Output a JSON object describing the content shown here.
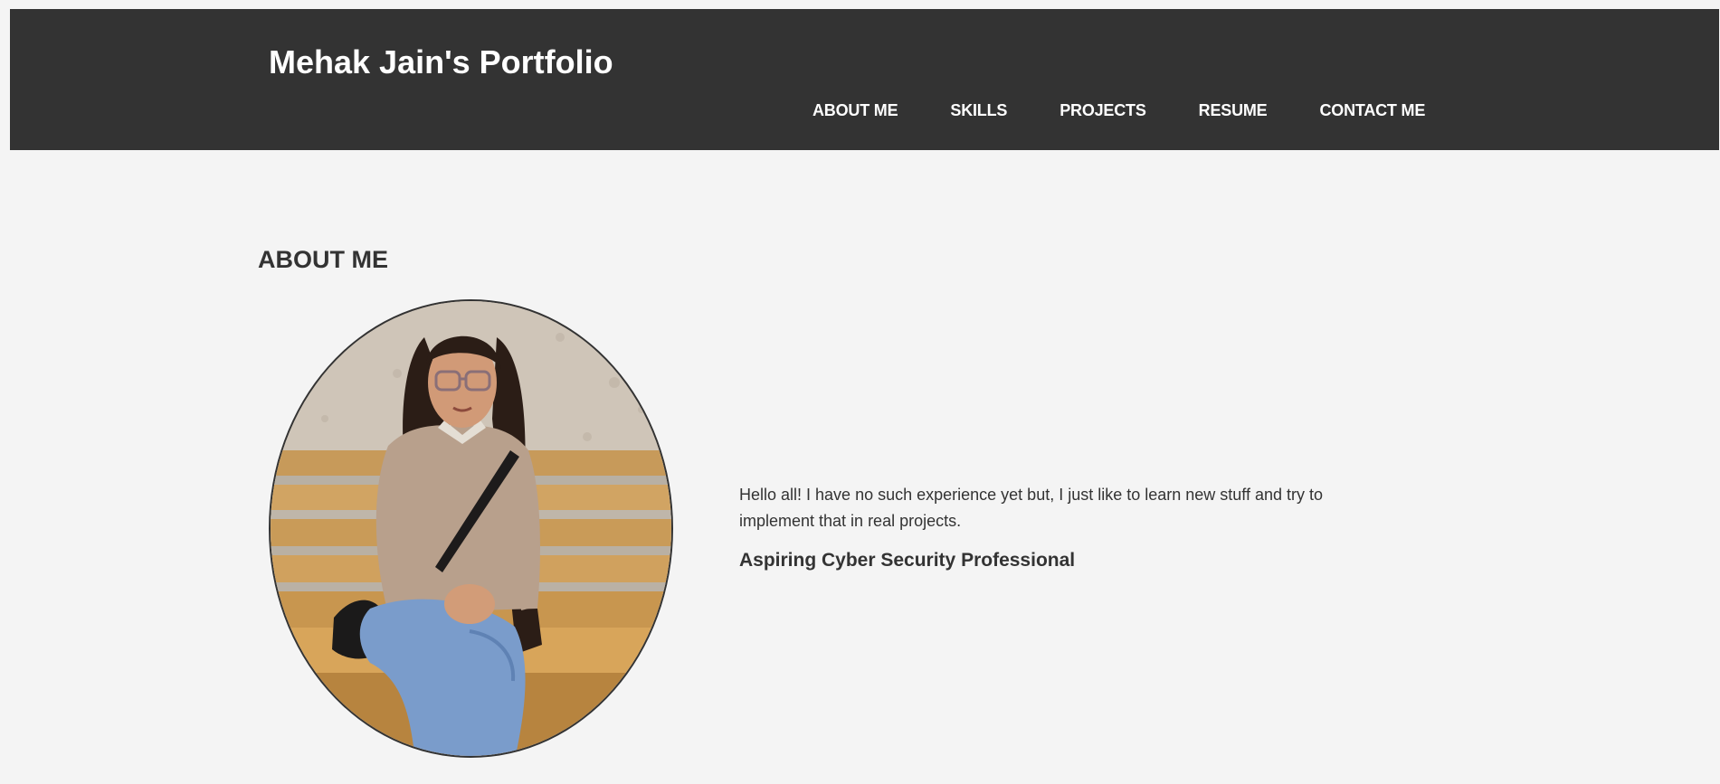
{
  "header": {
    "title": "Mehak Jain's Portfolio",
    "nav": [
      {
        "label": "ABOUT ME"
      },
      {
        "label": "SKILLS"
      },
      {
        "label": "PROJECTS"
      },
      {
        "label": "RESUME"
      },
      {
        "label": "CONTACT ME"
      }
    ]
  },
  "about": {
    "heading": "ABOUT ME",
    "description": "Hello all! I have no such experience yet but, I just like to learn new stuff and try to implement that in real projects.",
    "tagline": "Aspiring Cyber Security Professional"
  },
  "colors": {
    "header_bg": "#333333",
    "page_bg": "#f4f4f4",
    "text": "#333333",
    "nav_text": "#ffffff"
  }
}
